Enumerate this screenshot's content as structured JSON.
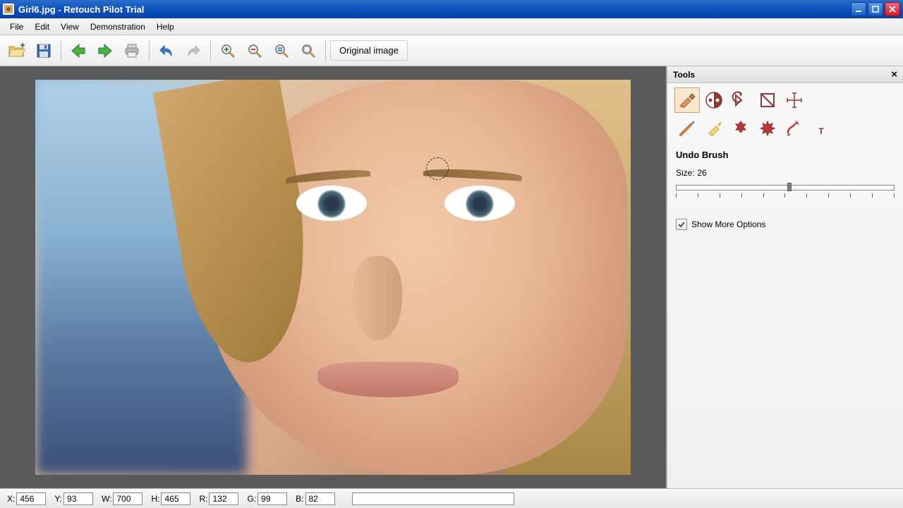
{
  "window": {
    "title": "Girl6.jpg - Retouch Pilot Trial"
  },
  "menu": [
    "File",
    "Edit",
    "View",
    "Demonstration",
    "Help"
  ],
  "toolbar": {
    "original_label": "Original image"
  },
  "tools_panel": {
    "title": "Tools",
    "active_tool_label": "Undo Brush",
    "size_label": "Size:",
    "size_value": "26",
    "more_options_label": "Show More Options"
  },
  "statusbar": {
    "x_label": "X:",
    "x_value": "456",
    "y_label": "Y:",
    "y_value": "93",
    "w_label": "W:",
    "w_value": "700",
    "h_label": "H:",
    "h_value": "465",
    "r_label": "R:",
    "r_value": "132",
    "g_label": "G:",
    "g_value": "99",
    "b_label": "B:",
    "b_value": "82"
  }
}
